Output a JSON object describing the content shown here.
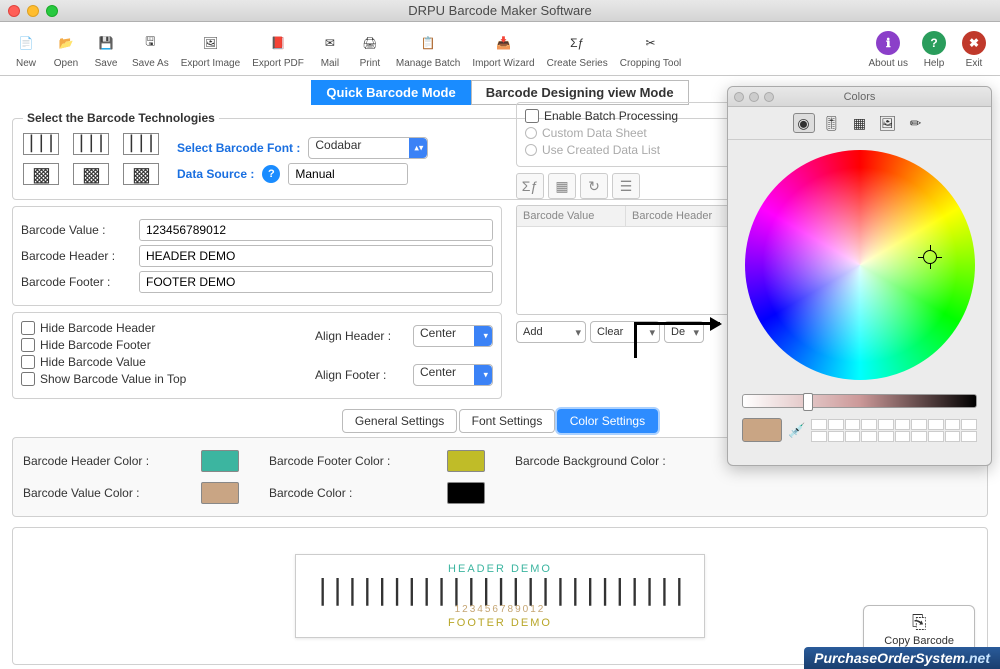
{
  "title": "DRPU Barcode Maker Software",
  "toolbar": [
    {
      "id": "new",
      "label": "New",
      "glyph": "📄"
    },
    {
      "id": "open",
      "label": "Open",
      "glyph": "📂"
    },
    {
      "id": "save",
      "label": "Save",
      "glyph": "💾"
    },
    {
      "id": "saveas",
      "label": "Save As",
      "glyph": "🖫"
    },
    {
      "id": "expimg",
      "label": "Export Image",
      "glyph": "🖼"
    },
    {
      "id": "exppdf",
      "label": "Export PDF",
      "glyph": "📕"
    },
    {
      "id": "mail",
      "label": "Mail",
      "glyph": "✉"
    },
    {
      "id": "print",
      "label": "Print",
      "glyph": "🖨"
    },
    {
      "id": "mbatch",
      "label": "Manage Batch",
      "glyph": "📋"
    },
    {
      "id": "impwiz",
      "label": "Import Wizard",
      "glyph": "📥"
    },
    {
      "id": "series",
      "label": "Create Series",
      "glyph": "Σƒ"
    },
    {
      "id": "crop",
      "label": "Cropping Tool",
      "glyph": "✂"
    }
  ],
  "toolbar_right": [
    {
      "id": "about",
      "label": "About us",
      "glyph": "ℹ"
    },
    {
      "id": "help",
      "label": "Help",
      "glyph": "?"
    },
    {
      "id": "exit",
      "label": "Exit",
      "glyph": "✖"
    }
  ],
  "modes": {
    "quick": "Quick Barcode Mode",
    "design": "Barcode Designing view Mode"
  },
  "tech": {
    "legend": "Select the Barcode Technologies",
    "font_label": "Select Barcode Font :",
    "font_value": "Codabar",
    "ds_label": "Data Source :",
    "ds_value": "Manual"
  },
  "batch": {
    "enable": "Enable Batch Processing",
    "custom": "Custom Data Sheet",
    "created": "Use Created Data List"
  },
  "values": {
    "bv_label": "Barcode Value :",
    "bv": "123456789012",
    "bh_label": "Barcode Header :",
    "bh": "HEADER DEMO",
    "bf_label": "Barcode Footer :",
    "bf": "FOOTER DEMO"
  },
  "opts": {
    "hide_header": "Hide Barcode Header",
    "hide_footer": "Hide Barcode Footer",
    "hide_value": "Hide Barcode Value",
    "show_top": "Show Barcode Value in Top",
    "align_header_lbl": "Align Header :",
    "align_header": "Center",
    "align_footer_lbl": "Align Footer :",
    "align_footer": "Center"
  },
  "table": {
    "col1": "Barcode Value",
    "col2": "Barcode Header",
    "add": "Add",
    "clear": "Clear",
    "del": "De"
  },
  "settings_tabs": {
    "general": "General Settings",
    "font": "Font Settings",
    "color": "Color Settings"
  },
  "colors": {
    "header_lbl": "Barcode Header Color :",
    "header": "#3cb5a0",
    "footer_lbl": "Barcode Footer Color :",
    "footer": "#c0bc28",
    "bg_lbl": "Barcode Background Color :",
    "value_lbl": "Barcode Value Color :",
    "value": "#c9a584",
    "barcode_lbl": "Barcode Color :",
    "barcode": "#000000"
  },
  "preview": {
    "header": "HEADER DEMO",
    "value": "123456789012",
    "footer": "FOOTER DEMO"
  },
  "copy_btn": "Copy Barcode",
  "picker": {
    "title": "Colors",
    "current": "#c9a584"
  },
  "watermark": "PurchaseOrderSystem",
  "watermark_suffix": ".net"
}
